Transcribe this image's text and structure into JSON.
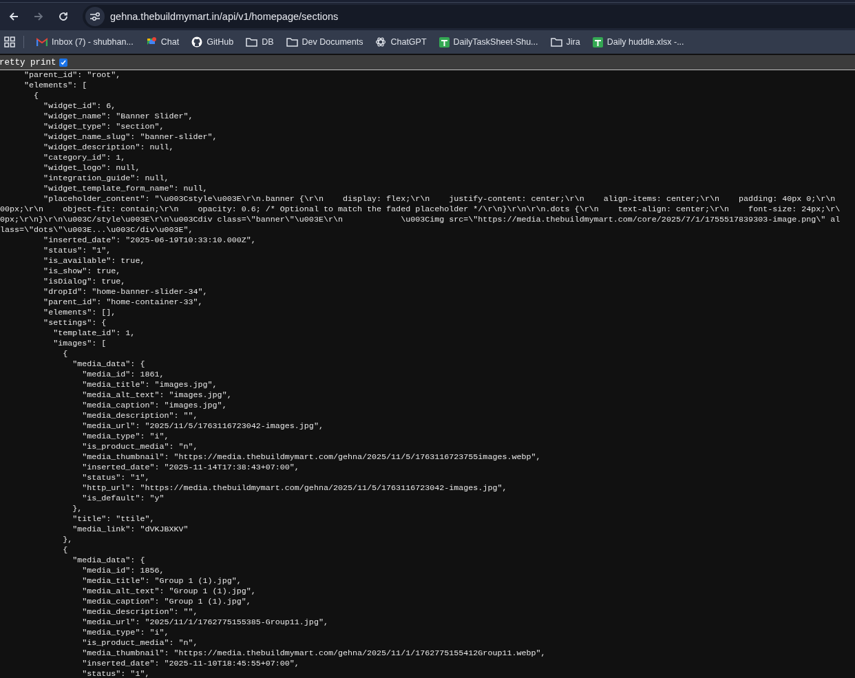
{
  "toolbar": {
    "nav_buttons": [
      {
        "kind": "back",
        "disabled": false
      },
      {
        "kind": "forward",
        "disabled": true
      },
      {
        "kind": "reload",
        "disabled": false
      }
    ],
    "address": "gehna.thebuildmymart.in/api/v1/homepage/sections"
  },
  "bookmarks": [
    {
      "kind": "gmail",
      "label": "Inbox (7) - shubhan..."
    },
    {
      "kind": "chat",
      "label": "Chat"
    },
    {
      "kind": "github",
      "label": "GitHub"
    },
    {
      "kind": "folder",
      "label": "DB"
    },
    {
      "kind": "folder",
      "label": "Dev Documents"
    },
    {
      "kind": "chatgpt",
      "label": "ChatGPT"
    },
    {
      "kind": "sheet",
      "label": "DailyTaskSheet-Shu..."
    },
    {
      "kind": "folder",
      "label": "Jira"
    },
    {
      "kind": "sheet",
      "label": "Daily huddle.xlsx -..."
    }
  ],
  "viewer": {
    "pretty_print": {
      "label": "retty print",
      "checked": true
    },
    "lines": [
      "     \"parent_id\": \"root\",",
      "     \"elements\": [",
      "       {",
      "         \"widget_id\": 6,",
      "         \"widget_name\": \"Banner Slider\",",
      "         \"widget_type\": \"section\",",
      "         \"widget_name_slug\": \"banner-slider\",",
      "         \"widget_description\": null,",
      "         \"category_id\": 1,",
      "         \"widget_logo\": null,",
      "         \"integration_guide\": null,",
      "         \"widget_template_form_name\": null,",
      "         \"placeholder_content\": \"\\u003Cstyle\\u003E\\r\\n.banner {\\r\\n    display: flex;\\r\\n    justify-content: center;\\r\\n    align-items: center;\\r\\n    padding: 40px 0;\\r\\n",
      "00px;\\r\\n    object-fit: contain;\\r\\n    opacity: 0.6; /* Optional to match the faded placeholder */\\r\\n}\\r\\n\\r\\n.dots {\\r\\n    text-align: center;\\r\\n    font-size: 24px;\\r\\",
      "0px;\\r\\n}\\r\\n\\u003C/style\\u003E\\r\\n\\u003Cdiv class=\\\"banner\\\"\\u003E\\r\\n            \\u003Cimg src=\\\"https://media.thebuildmymart.com/core/2025/7/1/1755517839303-image.png\\\" al",
      "lass=\\\"dots\\\"\\u003E...\\u003C/div\\u003E\",",
      "         \"inserted_date\": \"2025-06-19T10:33:10.000Z\",",
      "         \"status\": \"1\",",
      "         \"is_available\": true,",
      "         \"is_show\": true,",
      "         \"isDialog\": true,",
      "         \"dropId\": \"home-banner-slider-34\",",
      "         \"parent_id\": \"home-container-33\",",
      "         \"elements\": [],",
      "         \"settings\": {",
      "           \"template_id\": 1,",
      "           \"images\": [",
      "             {",
      "               \"media_data\": {",
      "                 \"media_id\": 1861,",
      "                 \"media_title\": \"images.jpg\",",
      "                 \"media_alt_text\": \"images.jpg\",",
      "                 \"media_caption\": \"images.jpg\",",
      "                 \"media_description\": \"\",",
      "                 \"media_url\": \"2025/11/5/1763116723042-images.jpg\",",
      "                 \"media_type\": \"i\",",
      "                 \"is_product_media\": \"n\",",
      "                 \"media_thumbnail\": \"https://media.thebuildmymart.com/gehna/2025/11/5/1763116723755images.webp\",",
      "                 \"inserted_date\": \"2025-11-14T17:38:43+07:00\",",
      "                 \"status\": \"1\",",
      "                 \"http_url\": \"https://media.thebuildmymart.com/gehna/2025/11/5/1763116723042-images.jpg\",",
      "                 \"is_default\": \"y\"",
      "               },",
      "               \"title\": \"ttile\",",
      "               \"media_link\": \"dVKJBXKV\"",
      "             },",
      "             {",
      "               \"media_data\": {",
      "                 \"media_id\": 1856,",
      "                 \"media_title\": \"Group 1 (1).jpg\",",
      "                 \"media_alt_text\": \"Group 1 (1).jpg\",",
      "                 \"media_caption\": \"Group 1 (1).jpg\",",
      "                 \"media_description\": \"\",",
      "                 \"media_url\": \"2025/11/1/1762775155385-Group11.jpg\",",
      "                 \"media_type\": \"i\",",
      "                 \"is_product_media\": \"n\",",
      "                 \"media_thumbnail\": \"https://media.thebuildmymart.com/gehna/2025/11/1/1762775155412Group11.webp\",",
      "                 \"inserted_date\": \"2025-11-10T18:45:55+07:00\",",
      "                 \"status\": \"1\","
    ]
  }
}
